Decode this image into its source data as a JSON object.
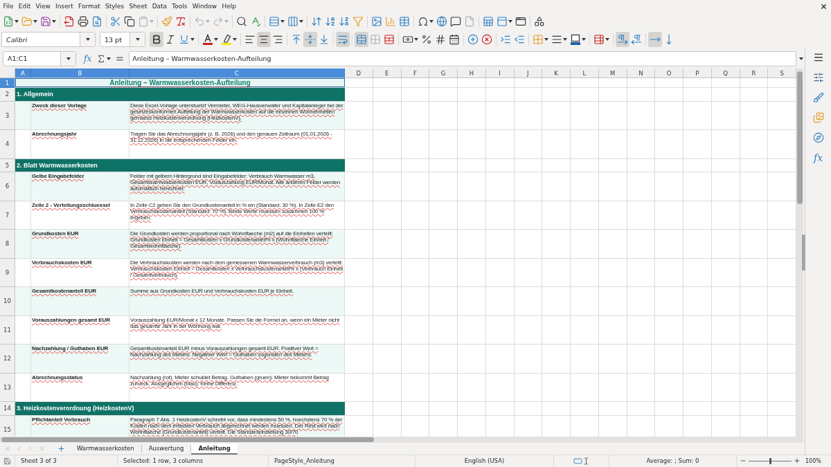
{
  "menu_bar": {
    "items": [
      "File",
      "Edit",
      "View",
      "Insert",
      "Format",
      "Styles",
      "Sheet",
      "Data",
      "Tools",
      "Window",
      "Help"
    ]
  },
  "standard_toolbar": {
    "paste_disabled": true,
    "undo_disabled": true,
    "redo_disabled": true,
    "header_footer_disabled": true
  },
  "formatting_toolbar": {
    "font_name": "Calibri",
    "font_size": "13 pt",
    "bold": true,
    "italic": false,
    "underline": false,
    "align_left": false,
    "align_center": true,
    "align_right": false,
    "align_top": false,
    "align_middle": true,
    "align_bottom": false,
    "wrap_text": true,
    "merge_and_center": true,
    "merge_cells_disabled": true,
    "left_to_right": true,
    "right_to_left": false,
    "text_horizontal": true,
    "text_vertical": false
  },
  "formula_bar": {
    "name_box": "A1:C1",
    "function_wizard": "fx",
    "content": "Anleitung – Warmwasserkosten-Aufteilung"
  },
  "sheet": {
    "auto_spellcheck": true,
    "columns": [
      {
        "label": "A",
        "selected": true
      },
      {
        "label": "B",
        "selected": true
      },
      {
        "label": "C",
        "selected": true
      },
      {
        "label": "D",
        "selected": false
      },
      {
        "label": "E",
        "selected": false
      },
      {
        "label": "F",
        "selected": false
      },
      {
        "label": "G",
        "selected": false
      },
      {
        "label": "H",
        "selected": false
      },
      {
        "label": "I",
        "selected": false
      },
      {
        "label": "J",
        "selected": false
      },
      {
        "label": "K",
        "selected": false
      },
      {
        "label": "L",
        "selected": false
      },
      {
        "label": "M",
        "selected": false
      },
      {
        "label": "N",
        "selected": false
      },
      {
        "label": "O",
        "selected": false
      },
      {
        "label": "P",
        "selected": false
      },
      {
        "label": "Q",
        "selected": false
      },
      {
        "label": "R",
        "selected": false
      },
      {
        "label": "S",
        "selected": false
      }
    ],
    "rows": [
      {
        "number": "1",
        "selected": true,
        "kind": "title",
        "text": "Anleitung – Warmwasserkosten-Aufteilung"
      },
      {
        "number": "2",
        "selected": false,
        "kind": "section",
        "text": "1. Allgemein"
      },
      {
        "number": "3",
        "selected": false,
        "kind": "entry",
        "shaded": true,
        "label": "Zweck dieser Vorlage",
        "description": "Diese Excel-Vorlage unterstuetzt Vermieter, WEG-Hausverwalter und Kapitalanleger bei der gesetzeskonformen Aufteilung der Warmwasserkosten auf die einzelnen Wohneinheiten gemaess Heizkostenverordnung (HeizkostenV)."
      },
      {
        "number": "4",
        "selected": false,
        "kind": "entry",
        "shaded": false,
        "label": "Abrechnungsjahr",
        "description": "Tragen Sie das Abrechnungsjahr (z. B. 2026) und den genauen Zeitraum (01.01.2026 - 31.12.2026) in die entsprechenden Felder ein."
      },
      {
        "number": "5",
        "selected": false,
        "kind": "section",
        "text": "2. Blatt Warmwasserkosten"
      },
      {
        "number": "6",
        "selected": false,
        "kind": "entry",
        "shaded": true,
        "label": "Gelbe Eingabefelder",
        "description": "Felder mit gelbem Hintergrund sind Eingabefelder: Verbrauch Warmwasser m3, Gesamtwarmwasserkosten EUR, Vorauszahlung EUR/Monat. Alle anderen Felder werden automatisch berechnet."
      },
      {
        "number": "7",
        "selected": false,
        "kind": "entry",
        "shaded": false,
        "label": "Zeile 2 - Verteilungsschluessel",
        "description": "In Zelle C2 geben Sie den Grundkostenanteil in % ein (Standard: 30 %). In Zelle E2 den Verbrauchskostenanteil (Standard: 70 %). Beide Werte muessen zusammen 100 % ergeben."
      },
      {
        "number": "8",
        "selected": false,
        "kind": "entry",
        "shaded": true,
        "label": "Grundkosten EUR",
        "description": "Die Grundkosten werden proportional nach Wohnflaeche (m2) auf die Einheiten verteilt: Grundkosten Einheit = Gesamtkosten x Grundkostenanteil% x (Wohnflaeche Einheit / Gesamtwohnflaeche)."
      },
      {
        "number": "9",
        "selected": false,
        "kind": "entry",
        "shaded": false,
        "label": "Verbrauchskosten EUR",
        "description": "Die Verbrauchskosten werden nach dem gemessenen Warmwasserverbrauch (m3) verteilt: Verbrauchskosten Einheit = Gesamtkosten x Verbrauchskostenanteil% x (Verbrauch Einheit / Gesamtverbrauch)."
      },
      {
        "number": "10",
        "selected": false,
        "kind": "entry",
        "shaded": true,
        "label": "Gesamtkostenanteil EUR",
        "description": "Summe aus Grundkosten EUR und Verbrauchskosten EUR je Einheit."
      },
      {
        "number": "11",
        "selected": false,
        "kind": "entry",
        "shaded": false,
        "label": "Vorauszahlungen gesamt EUR",
        "description": "Vorauszahlung EUR/Monat x 12 Monate. Passen Sie die Formel an, wenn ein Mieter nicht das gesamte Jahr in der Wohnung war."
      },
      {
        "number": "12",
        "selected": false,
        "kind": "entry",
        "shaded": true,
        "label": "Nachzahlung / Guthaben EUR",
        "description": "Gesamtkostenanteil EUR minus Vorauszahlungen gesamt EUR. Positiver Wert = Nachzahlung des Mieters. Negativer Wert = Guthaben zugunsten des Mieters."
      },
      {
        "number": "13",
        "selected": false,
        "kind": "entry",
        "shaded": false,
        "label": "Abrechnungsstatus",
        "description": "Nachzahlung (rot): Mieter schuldet Betrag. Guthaben (gruen): Mieter bekommt Betrag zurueck. Ausgeglichen (blau): Keine Differenz."
      },
      {
        "number": "14",
        "selected": false,
        "kind": "section",
        "text": "3. Heizkostenverordnung (HeizkostenV)"
      },
      {
        "number": "15",
        "selected": false,
        "kind": "entry",
        "shaded": true,
        "label": "Pflichtanteil Verbrauch",
        "description": "Paragraph 7 Abs. 1 HeizkostenV schreibt vor, dass mindestens 50 %, hoechstens 70 % der Kosten nach dem erfassten Verbrauch abgerechnet werden muessen. Der Rest wird nach Wohnflaeche (Grundkostenanteil) verteilt. Die Standardeinstellung 30/70"
      }
    ]
  },
  "sheet_tabs": {
    "navigation_disabled": true,
    "tabs": [
      {
        "label": "Warmwasserkosten",
        "selected": false
      },
      {
        "label": "Auswertung",
        "selected": false
      },
      {
        "label": "Anleitung",
        "selected": true
      }
    ]
  },
  "sidebar": {
    "functions": "fx"
  },
  "status_bar": {
    "sheet": "Sheet 3 of 3",
    "selection": "Selected: 1 row, 3 columns",
    "page_style": "PageStyle_Anleitung",
    "language": "English (USA)",
    "summary": "Average: ; Sum: 0",
    "zoom": {
      "level": 0.5,
      "reading": "100%"
    }
  }
}
